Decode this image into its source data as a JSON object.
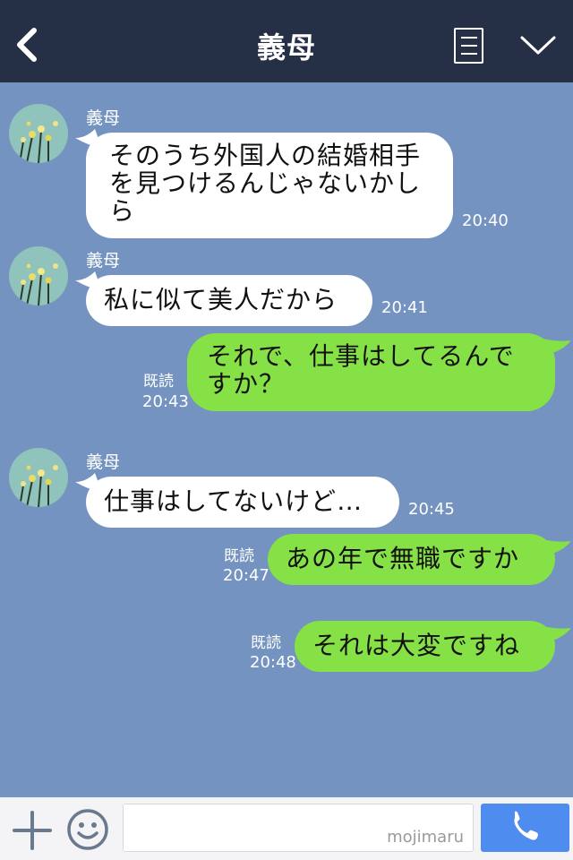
{
  "header": {
    "title": "義母",
    "back_icon": "chevron-left-icon",
    "menu_icon": "menu-icon",
    "expand_icon": "chevron-down-icon"
  },
  "colors": {
    "header_bg": "#252f45",
    "chat_bg": "#7493c0",
    "incoming_bubble": "#ffffff",
    "outgoing_bubble": "#86e147",
    "call_button": "#4e8cf0"
  },
  "messages": [
    {
      "direction": "incoming",
      "sender": "義母",
      "text": "そのうち外国人の結婚相手を見つけるんじゃないかしら",
      "time": "20:40"
    },
    {
      "direction": "incoming",
      "sender": "義母",
      "text": "私に似て美人だから",
      "time": "20:41"
    },
    {
      "direction": "outgoing",
      "text": "それで、仕事はしてるんですか？",
      "read": "既読",
      "time": "20:43"
    },
    {
      "direction": "incoming",
      "sender": "義母",
      "text": "仕事はしてないけど…",
      "time": "20:45"
    },
    {
      "direction": "outgoing",
      "text": "あの年で無職ですか",
      "read": "既読",
      "time": "20:47"
    },
    {
      "direction": "outgoing",
      "text": "それは大変ですね",
      "read": "既読",
      "time": "20:48"
    }
  ],
  "footer": {
    "plus_icon": "plus-icon",
    "emoji_icon": "smiley-icon",
    "input_value": "",
    "input_placeholder": "",
    "watermark": "mojimaru",
    "call_icon": "phone-icon"
  }
}
